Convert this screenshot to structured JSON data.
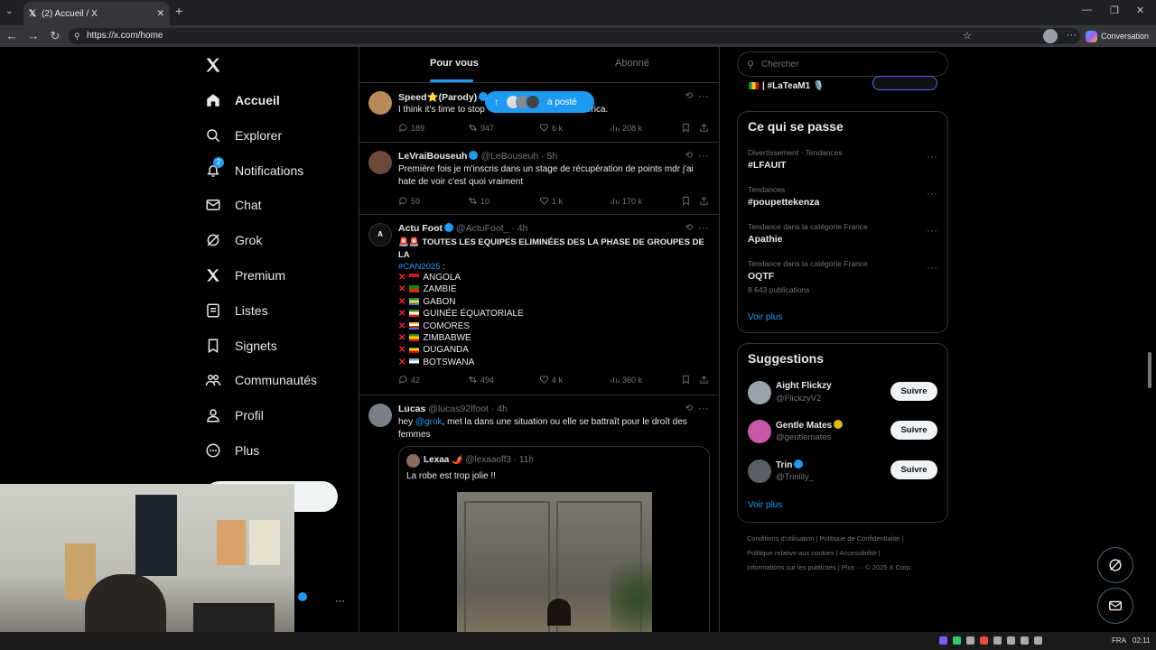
{
  "browser": {
    "tab_title": "(2) Accueil / X",
    "url": "https://x.com/home",
    "conversation_label": "Conversation"
  },
  "nav": {
    "items": [
      {
        "label": "Accueil",
        "icon": "home-icon"
      },
      {
        "label": "Explorer",
        "icon": "search-icon"
      },
      {
        "label": "Notifications",
        "icon": "bell-icon",
        "badge": "2"
      },
      {
        "label": "Chat",
        "icon": "mail-icon"
      },
      {
        "label": "Grok",
        "icon": "grok-icon"
      },
      {
        "label": "Premium",
        "icon": "x-logo-icon"
      },
      {
        "label": "Listes",
        "icon": "list-icon"
      },
      {
        "label": "Signets",
        "icon": "bookmark-icon"
      },
      {
        "label": "Communautés",
        "icon": "communities-icon"
      },
      {
        "label": "Profil",
        "icon": "user-icon"
      },
      {
        "label": "Plus",
        "icon": "more-circle-icon"
      }
    ]
  },
  "feed": {
    "tabs": [
      "Pour vous",
      "Abonné"
    ],
    "new_posts_pill": "a posté",
    "tweets": [
      {
        "name": "Speed⭐(Parody)",
        "text": "I think it's time to stop",
        "text_tail": "out Africa.",
        "replies": "189",
        "retweets": "947",
        "likes": "6 k",
        "views": "208 k"
      },
      {
        "name": "LeVraiBouseuh",
        "handle": "@LeBouseuh",
        "time": "· 5h",
        "text": "Première fois je m'inscris dans un stage de récupération de points mdr j'ai hate de voir c'est quoi vraiment",
        "replies": "59",
        "retweets": "10",
        "likes": "1 k",
        "views": "170 k"
      },
      {
        "name": "Actu Foot",
        "handle": "@ActuFoot_",
        "time": "· 4h",
        "text": "TOUTES LES EQUIPES ELIMINÉES DES LA PHASE DE GROUPES DE LA",
        "hashtag": "#CAN2025",
        "text_after_hashtag": " :",
        "teams": [
          "ANGOLA",
          "ZAMBIE",
          "GABON",
          "GUINÉE ÉQUATORIALE",
          "COMORES",
          "ZIMBABWE",
          "OUGANDA",
          "BOTSWANA"
        ],
        "replies": "42",
        "retweets": "494",
        "likes": "4 k",
        "views": "360 k"
      },
      {
        "name": "Lucas",
        "handle": "@lucas92lfoot",
        "time": "· 4h",
        "text_pre": "hey ",
        "mention": "@grok",
        "text": ", met la dans une situation ou elle se battraît pour le droît des femmes",
        "quote": {
          "name": "Lexaa 🌶️",
          "handle": "@lexaaoff3",
          "time": "· 11h",
          "text": "La robe est trop jolie !!"
        }
      }
    ]
  },
  "sidebar": {
    "search_placeholder": "Chercher",
    "top_snippet": "| #LaTeaM1 🎙️",
    "trends_title": "Ce qui se passe",
    "trends": [
      {
        "meta": "Divertissement · Tendances",
        "title": "#LFAUIT",
        "count": ""
      },
      {
        "meta": "Tendances",
        "title": "#poupettekenza",
        "count": ""
      },
      {
        "meta": "Tendance dans la catégorie France",
        "title": "Apathie",
        "count": ""
      },
      {
        "meta": "Tendance dans la catégorie France",
        "title": "OQTF",
        "count": "8 643 publications"
      }
    ],
    "show_more": "Voir plus",
    "suggestions_title": "Suggestions",
    "suggestions": [
      {
        "name": "Aight Flickzy",
        "handle": "@FlickzyV2",
        "follow": "Suivre"
      },
      {
        "name": "Gentle Mates",
        "handle": "@gentlemates",
        "follow": "Suivre"
      },
      {
        "name": "Trin",
        "handle": "@Trinlily_",
        "follow": "Suivre"
      }
    ],
    "footer_line1": "Conditions d'utilisation  |  Politique de Confidentialité  |",
    "footer_line2": "Politique relative aux cookies  |  Accessibilité  |",
    "footer_line3": "Informations sur les publicités  |  Plus ···  © 2025 X Corp."
  },
  "taskbar": {
    "lang": "FRA",
    "time": "02:11"
  },
  "colors": {
    "accent": "#1d9bf0",
    "bg": "#000000",
    "border": "#2f3336",
    "muted": "#71767b"
  }
}
